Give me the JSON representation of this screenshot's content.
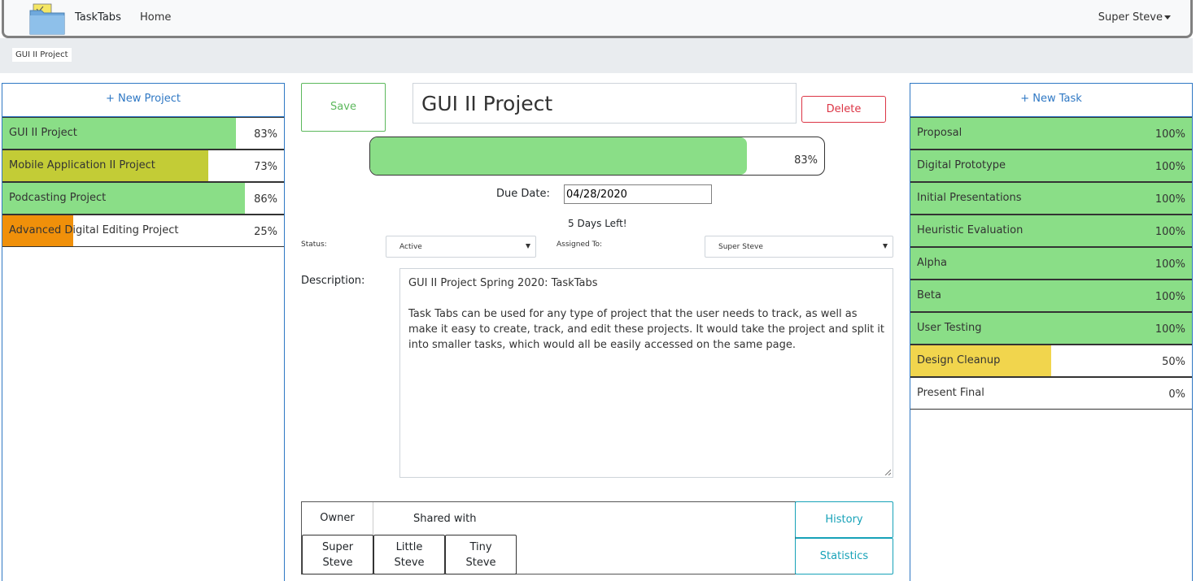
{
  "navbar": {
    "brand": "TaskTabs",
    "home": "Home",
    "user": "Super Steve"
  },
  "breadcrumb": "GUI II Project",
  "projects": {
    "new_label": "+ New Project",
    "items": [
      {
        "name": "GUI II Project",
        "pct_label": "83%",
        "progress": 0.83,
        "color": "#8ade87"
      },
      {
        "name": "Mobile Application II Project",
        "pct_label": "73%",
        "progress": 0.73,
        "color": "#c3cc36"
      },
      {
        "name": "Podcasting Project",
        "pct_label": "86%",
        "progress": 0.86,
        "color": "#8ade87"
      },
      {
        "name": "Advanced Digital Editing Project",
        "pct_label": "25%",
        "progress": 0.25,
        "color": "#f0900a"
      }
    ]
  },
  "editor": {
    "save_label": "Save",
    "title_value": "GUI II Project",
    "delete_label": "Delete",
    "progress": 0.83,
    "progress_label": "83%",
    "due_label": "Due Date:",
    "due_value": "04/28/2020",
    "days_left": "5 Days Left!",
    "status_label": "Status:",
    "status_value": "Active",
    "assigned_label": "Assigned To:",
    "assigned_value": "Super Steve",
    "description_label": "Description:",
    "description": "GUI II Project Spring 2020: TaskTabs\n\nTask Tabs can be used for any type of project that the user needs to track, as well as make it easy to create, track, and edit these projects. It would take the project and split it into smaller tasks, which would all be easily accessed on the same page.",
    "owner_label": "Owner",
    "shared_label": "Shared with",
    "owner": "Super\nSteve",
    "shared": [
      "Little\nSteve",
      "Tiny\nSteve"
    ],
    "history_label": "History",
    "statistics_label": "Statistics"
  },
  "tasks": {
    "new_label": "+ New Task",
    "items": [
      {
        "name": "Proposal",
        "pct_label": "100%",
        "progress": 1.0,
        "color": "#8ade87"
      },
      {
        "name": "Digital Prototype",
        "pct_label": "100%",
        "progress": 1.0,
        "color": "#8ade87"
      },
      {
        "name": "Initial Presentations",
        "pct_label": "100%",
        "progress": 1.0,
        "color": "#8ade87"
      },
      {
        "name": "Heuristic Evaluation",
        "pct_label": "100%",
        "progress": 1.0,
        "color": "#8ade87"
      },
      {
        "name": "Alpha",
        "pct_label": "100%",
        "progress": 1.0,
        "color": "#8ade87"
      },
      {
        "name": "Beta",
        "pct_label": "100%",
        "progress": 1.0,
        "color": "#8ade87"
      },
      {
        "name": "User Testing",
        "pct_label": "100%",
        "progress": 1.0,
        "color": "#8ade87"
      },
      {
        "name": "Design Cleanup",
        "pct_label": "50%",
        "progress": 0.5,
        "color": "#f1d54d"
      },
      {
        "name": "Present Final",
        "pct_label": "0%",
        "progress": 0.0,
        "color": "#8ade87"
      }
    ]
  }
}
